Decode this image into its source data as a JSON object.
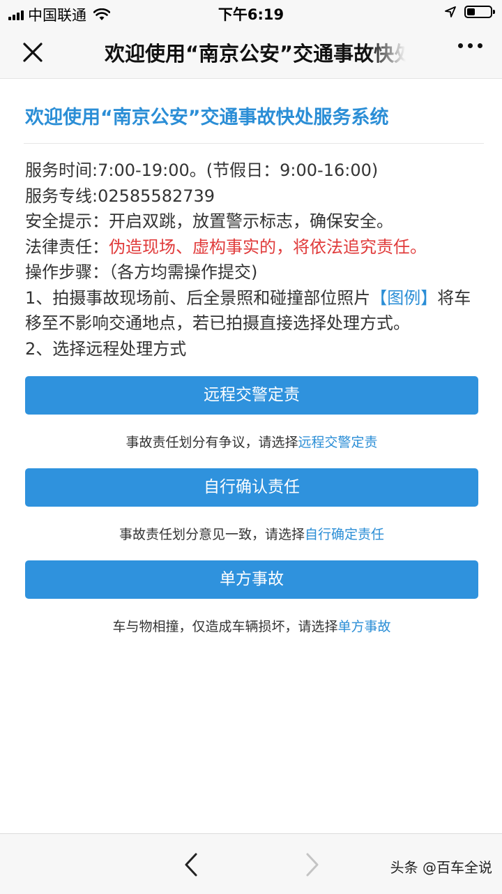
{
  "status_bar": {
    "carrier": "中国联通",
    "time": "下午6:19",
    "battery_level": 0.35
  },
  "nav": {
    "title": "欢迎使用“南京公安”交通事故快处服务系统"
  },
  "page": {
    "title": "欢迎使用“南京公安”交通事故快处服务系统",
    "service_hours": "服务时间:7:00-19:00。(节假日：9:00-16:00)",
    "hotline": "服务专线:02585582739",
    "safety_tip": "安全提示：开启双跳，放置警示标志，确保安全。",
    "legal_label": "法律责任：",
    "legal_text": "伪造现场、虚构事实的，将依法追究责任。",
    "steps_label": "操作步骤：（各方均需操作提交)",
    "step1_text": "1、拍摄事故现场前、后全景照和碰撞部位照片",
    "step1_link": "【图例】",
    "step1_cont": "将车移至不影响交通地点，若已拍摄直接选择处理方式。",
    "step2_text": "2、选择远程处理方式"
  },
  "options": [
    {
      "button_label": "远程交警定责",
      "hint_text": "事故责任划分有争议，请选择",
      "hint_link": "远程交警定责"
    },
    {
      "button_label": "自行确认责任",
      "hint_text": "事故责任划分意见一致，请选择",
      "hint_link": "自行确定责任"
    },
    {
      "button_label": "单方事故",
      "hint_text": "车与物相撞，仅造成车辆损坏，请选择",
      "hint_link": "单方事故"
    }
  ],
  "watermark": "头条 @百车全说",
  "colors": {
    "accent": "#2f92dd",
    "link": "#2b8ed6",
    "warning": "#e03b3b"
  },
  "icons": {
    "close": "close-icon",
    "more": "more-icon",
    "back": "chevron-left-icon",
    "forward": "chevron-right-icon"
  }
}
